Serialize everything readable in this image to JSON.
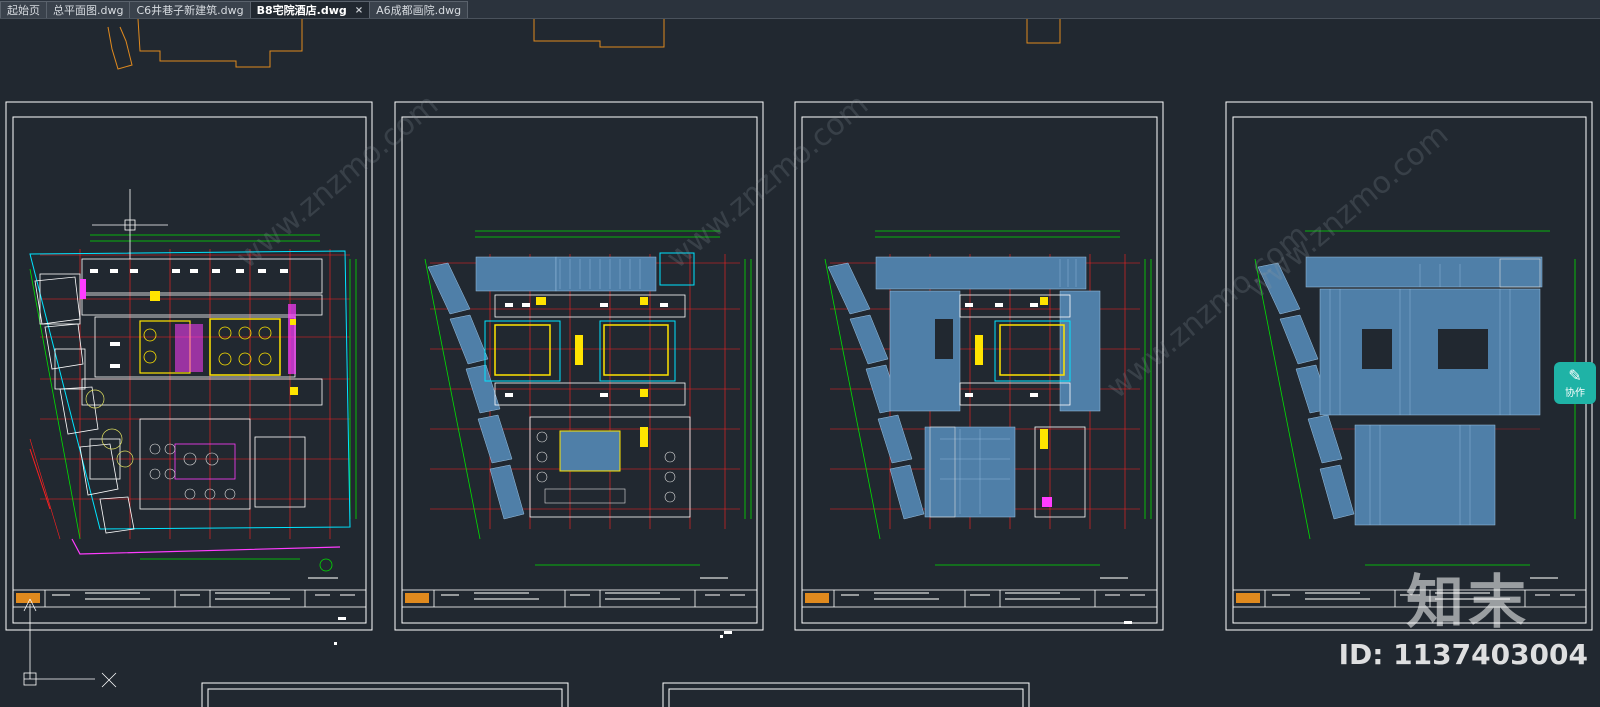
{
  "tabs": [
    {
      "label": "起始页",
      "active": false
    },
    {
      "label": "总平面图.dwg",
      "active": false
    },
    {
      "label": "C6井巷子新建筑.dwg",
      "active": false
    },
    {
      "label": "B8宅院酒店.dwg",
      "active": true,
      "close": "×"
    },
    {
      "label": "A6成都画院.dwg",
      "active": false
    }
  ],
  "watermark": {
    "logo": "知末",
    "id_text": "ID: 1137403004",
    "diagonal": "www.znzmo.com"
  },
  "collab_button": {
    "icon": "chat-icon",
    "label": "协作"
  },
  "colors": {
    "background": "#212830",
    "frame": "#ffffff",
    "wall_cyan": "#00e5ff",
    "grid_red": "#ff2020",
    "dim_green": "#00e000",
    "fill_blue": "#4f7fa8",
    "yellow": "#ffe400",
    "magenta": "#ff3cff",
    "orange": "#e08a1e"
  }
}
